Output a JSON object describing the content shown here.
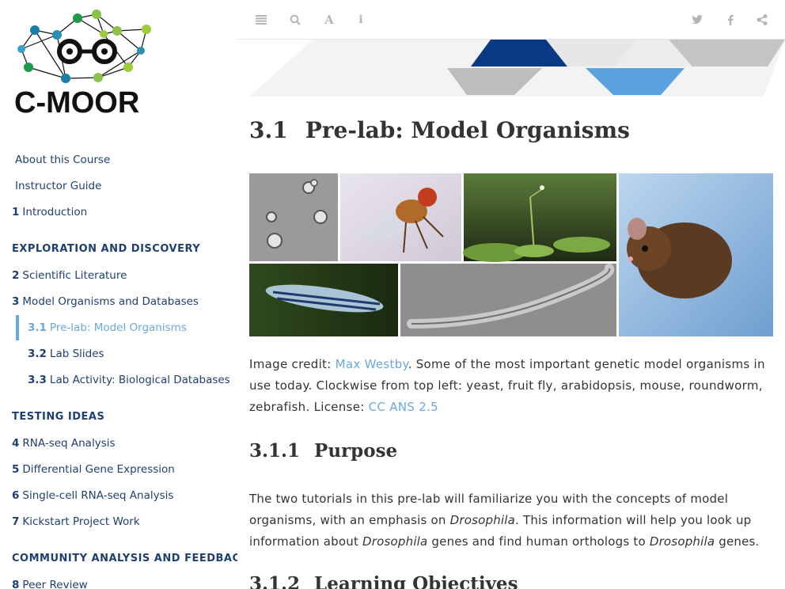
{
  "logo": {
    "text": "C-MOOR"
  },
  "toolbar": {
    "toggle_icon": "hamburger-icon",
    "search_icon": "search-icon",
    "font_icon": "font-settings-icon",
    "info_icon": "info-icon",
    "twitter_icon": "twitter-icon",
    "facebook_icon": "facebook-icon",
    "share_icon": "share-icon"
  },
  "sidebar": {
    "items": [
      {
        "num": "",
        "label": "About this Course"
      },
      {
        "num": "",
        "label": "Instructor Guide"
      },
      {
        "num": "1",
        "label": "Introduction"
      }
    ],
    "header1": "EXPLORATION AND DISCOVERY",
    "items2": [
      {
        "num": "2",
        "label": "Scientific Literature"
      },
      {
        "num": "3",
        "label": "Model Organisms and Databases"
      },
      {
        "num": "3.1",
        "label": "Pre-lab: Model Organisms"
      },
      {
        "num": "3.2",
        "label": "Lab Slides"
      },
      {
        "num": "3.3",
        "label": "Lab Activity: Biological Databases"
      }
    ],
    "header2": "TESTING IDEAS",
    "items3": [
      {
        "num": "4",
        "label": "RNA-seq Analysis"
      },
      {
        "num": "5",
        "label": "Differential Gene Expression"
      },
      {
        "num": "6",
        "label": "Single-cell RNA-seq Analysis"
      },
      {
        "num": "7",
        "label": "Kickstart Project Work"
      }
    ],
    "header3": "COMMUNITY ANALYSIS AND FEEDBACK",
    "items4": [
      {
        "num": "8",
        "label": "Peer Review"
      }
    ]
  },
  "main": {
    "section_num": "3.1",
    "section_title": "Pre-lab: Model Organisms",
    "caption_prefix": "Image credit: ",
    "caption_author": "Max Westby",
    "caption_body": ". Some of the most important genetic model organisms in use today. Clockwise from top left: yeast, fruit fly, arabidopsis, mouse, roundworm, zebrafish. License: ",
    "caption_license": "CC ANS 2.5",
    "purpose_num": "3.1.1",
    "purpose_title": "Purpose",
    "purpose_p1": "The two tutorials in this pre-lab will familiarize you with the concepts of model organisms, with an emphasis on ",
    "purpose_em1": "Drosophila",
    "purpose_p2": ". This information will help you look up information about ",
    "purpose_em2": "Drosophila",
    "purpose_p3": " genes and find human orthologs to ",
    "purpose_em3": "Drosophila",
    "purpose_p4": " genes.",
    "lo_num": "3.1.2",
    "lo_title": "Learning Objectives"
  },
  "colors": {
    "nav_text": "#1f3f73",
    "active": "#6aa9dd",
    "link": "#6aa9dd",
    "banner_dark": "#0a3a86",
    "banner_light": "#5ba3e0"
  }
}
